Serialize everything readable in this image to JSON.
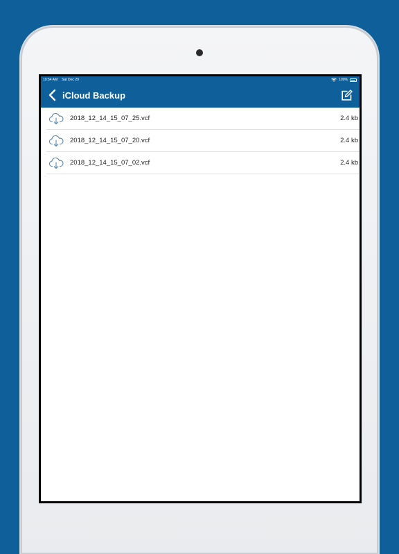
{
  "statusbar": {
    "time": "10:54 AM",
    "date": "Sat Dec 29",
    "battery": "100%"
  },
  "navbar": {
    "title": "iCloud Backup",
    "back_icon": "chevron-left-icon",
    "edit_icon": "edit-icon"
  },
  "files": [
    {
      "name": "2018_12_14_15_07_25.vcf",
      "size": "2.4 kb",
      "icon": "cloud-download-icon"
    },
    {
      "name": "2018_12_14_15_07_20.vcf",
      "size": "2.4 kb",
      "icon": "cloud-download-icon"
    },
    {
      "name": "2018_12_14_15_07_02.vcf",
      "size": "2.4 kb",
      "icon": "cloud-download-icon"
    }
  ],
  "colors": {
    "brand": "#0e5f9a",
    "background": "#0e5f9a",
    "icon_blue": "#4f86b6",
    "divider": "#dde0e3"
  }
}
